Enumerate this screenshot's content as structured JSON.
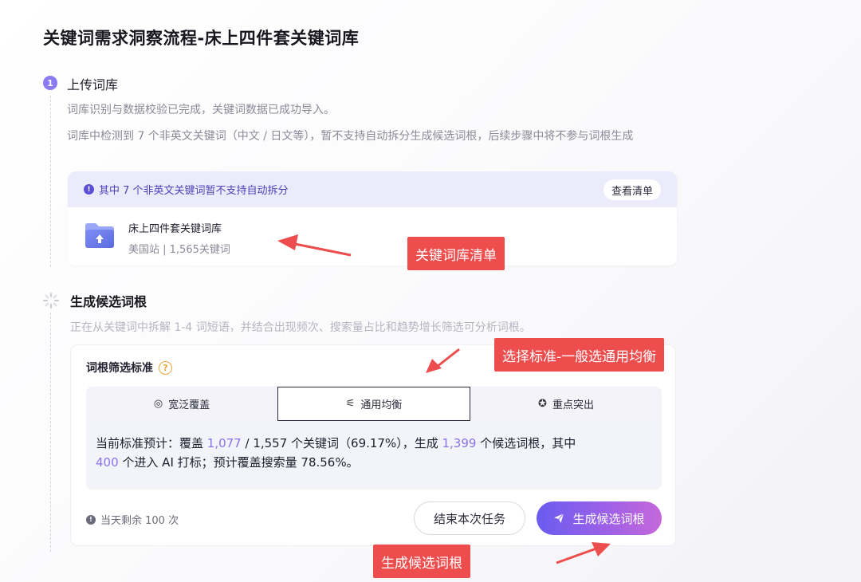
{
  "page_title": "关键词需求洞察流程-床上四件套关键词库",
  "step1": {
    "number": "1",
    "title": "上传词库",
    "desc_line1": "词库识别与数据校验已完成，关键词数据已成功导入。",
    "desc_line2": "词库中检测到 7 个非英文关键词（中文 / 日文等），暂不支持自动拆分生成候选词根，后续步骤中将不参与词根生成",
    "notice": "其中 7 个非英文关键词暂不支持自动拆分",
    "view_list": "查看清单",
    "file_name": "床上四件套关键词库",
    "file_meta": "美国站 | 1,565关键词"
  },
  "step2": {
    "title": "生成候选词根",
    "desc": "正在从关键词中拆解 1-4 词短语，并结合出现频次、搜索量占比和趋势增长筛选可分析词根。",
    "criteria_label": "词根筛选标准",
    "help": "?",
    "tabs": [
      {
        "label": "宽泛覆盖",
        "icon": "radar-icon"
      },
      {
        "label": "通用均衡",
        "icon": "sliders-icon"
      },
      {
        "label": "重点突出",
        "icon": "star-icon"
      }
    ],
    "stats": {
      "t1": "当前标准预计：覆盖 ",
      "covered": "1,077",
      "t2": " / 1,557 个关键词（69.17%），生成 ",
      "generated": "1,399",
      "t3": " 个候选词根，其中",
      "ai_count": "400",
      "t4": " 个进入 AI 打标；预计覆盖搜索量 78.56%。"
    },
    "quota": "当天剩余 100 次",
    "end_button": "结束本次任务",
    "generate_button": "生成候选词根"
  },
  "annotations": {
    "list_callout": "关键词库清单",
    "criteria_callout": "选择标准-一般选通用均衡",
    "generate_callout": "生成候选词根"
  },
  "colors": {
    "accent": "#8b7bf3",
    "highlight": "#8a73e8",
    "callout": "#ee4d4d"
  }
}
